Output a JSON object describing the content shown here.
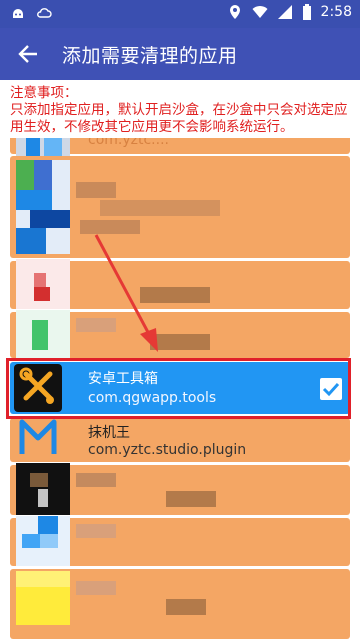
{
  "status_bar": {
    "time": "2:58",
    "icons": [
      "android-icon",
      "cloud-icon",
      "location-icon",
      "wifi-icon",
      "signal-icon",
      "battery-icon"
    ]
  },
  "app_bar": {
    "back_icon": "arrow-back-icon",
    "title": "添加需要清理的应用"
  },
  "notice": {
    "heading": "注意事项：",
    "body": "只添加指定应用，默认开启沙盒，在沙盒中只会对选定应用生效，不修改其它应用更不会影响系统运行。"
  },
  "apps": [
    {
      "name": "",
      "package": "com.yztc....",
      "blurred": true
    },
    {
      "name": "",
      "package": "",
      "blurred": true
    },
    {
      "name": "",
      "package": "",
      "blurred": true
    },
    {
      "name": "",
      "package": "",
      "blurred": true
    },
    {
      "name": "安卓工具箱",
      "package": "com.qgwapp.tools",
      "selected": true,
      "icon": "tools-wrench-screwdriver-icon"
    },
    {
      "name": "抹机王",
      "package": "com.yztc.studio.plugin",
      "icon": "m-logo-icon"
    },
    {
      "name": "",
      "package": "",
      "blurred": true
    },
    {
      "name": "",
      "package": "",
      "blurred": true
    },
    {
      "name": "",
      "package": "",
      "blurred": true
    }
  ],
  "colors": {
    "status_bar": "#3a4fb0",
    "app_bar": "#3f51b5",
    "row_bg": "#f4a664",
    "selected_row": "#2196f3",
    "notice_text": "#e02020",
    "highlight": "#e0202a"
  }
}
